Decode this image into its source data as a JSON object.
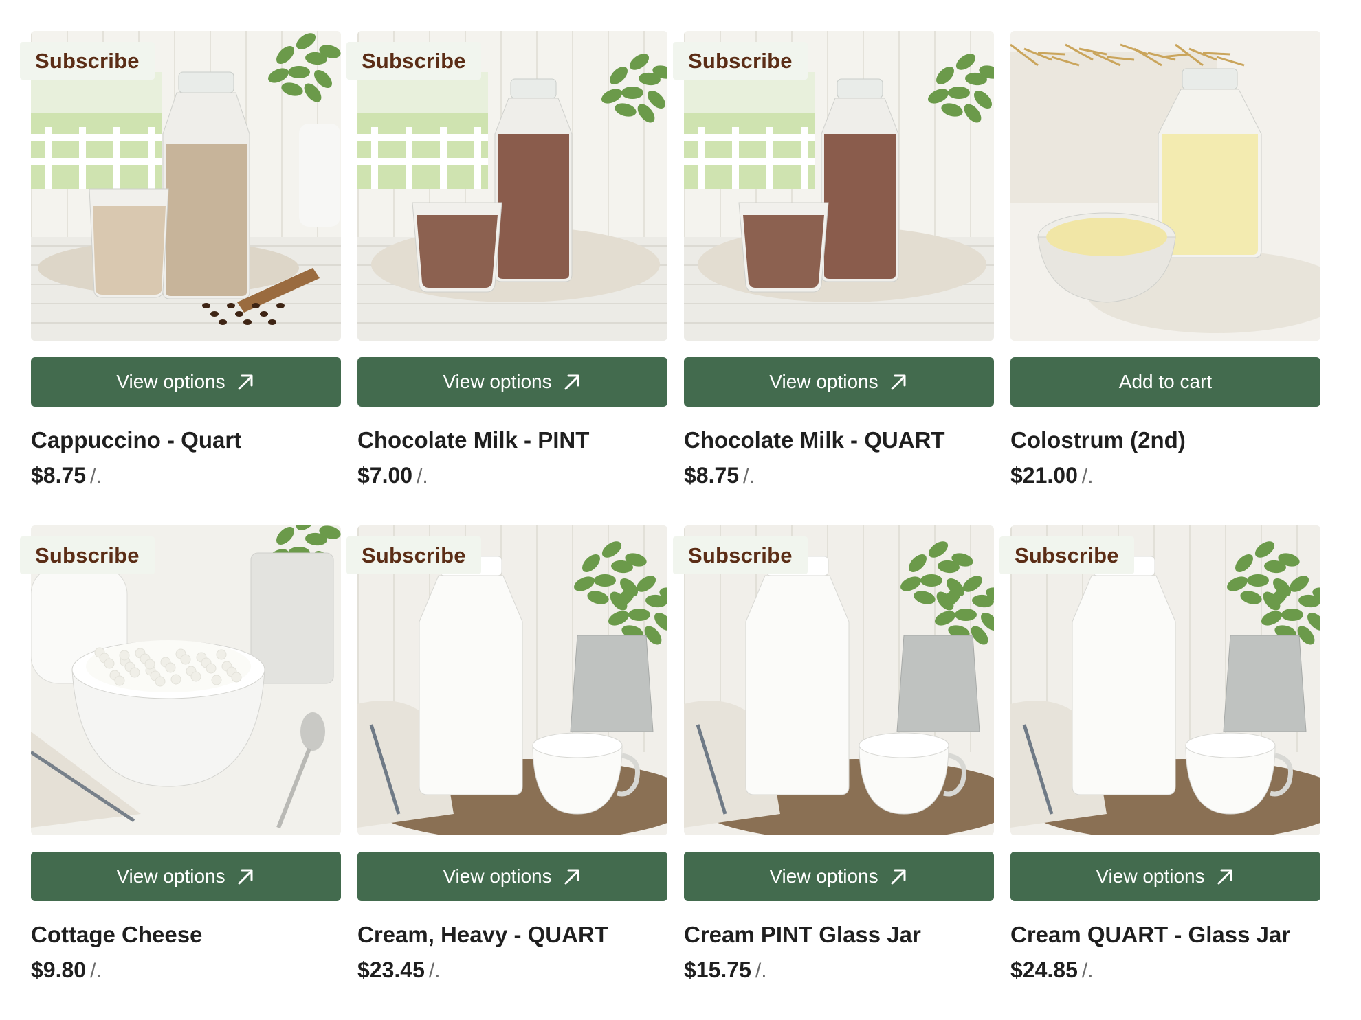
{
  "products": [
    {
      "badge": "Subscribe",
      "button_label": "View options",
      "button_icon": "arrow-up-right-icon",
      "name": "Cappuccino - Quart",
      "price": "$8.75",
      "unit": "/.",
      "image": "cappuccino"
    },
    {
      "badge": "Subscribe",
      "button_label": "View options",
      "button_icon": "arrow-up-right-icon",
      "name": "Chocolate Milk - PINT",
      "price": "$7.00",
      "unit": "/.",
      "image": "chocolate"
    },
    {
      "badge": "Subscribe",
      "button_label": "View options",
      "button_icon": "arrow-up-right-icon",
      "name": "Chocolate Milk - QUART",
      "price": "$8.75",
      "unit": "/.",
      "image": "chocolate"
    },
    {
      "badge": "",
      "button_label": "Add to cart",
      "button_icon": "",
      "name": "Colostrum (2nd)",
      "price": "$21.00",
      "unit": "/.",
      "image": "colostrum"
    },
    {
      "badge": "Subscribe",
      "button_label": "View options",
      "button_icon": "arrow-up-right-icon",
      "name": "Cottage Cheese",
      "price": "$9.80",
      "unit": "/.",
      "image": "cottage"
    },
    {
      "badge": "Subscribe",
      "button_label": "View options",
      "button_icon": "arrow-up-right-icon",
      "name": "Cream, Heavy - QUART",
      "price": "$23.45",
      "unit": "/.",
      "image": "cream"
    },
    {
      "badge": "Subscribe",
      "button_label": "View options",
      "button_icon": "arrow-up-right-icon",
      "name": "Cream PINT Glass Jar",
      "price": "$15.75",
      "unit": "/.",
      "image": "cream"
    },
    {
      "badge": "Subscribe",
      "button_label": "View options",
      "button_icon": "arrow-up-right-icon",
      "name": "Cream QUART - Glass Jar",
      "price": "$24.85",
      "unit": "/.",
      "image": "cream"
    }
  ],
  "colors": {
    "button_bg": "#436b4e",
    "badge_bg": "#f1f5ee",
    "badge_text": "#5b2d16",
    "unit_text": "#6b6b6b"
  }
}
